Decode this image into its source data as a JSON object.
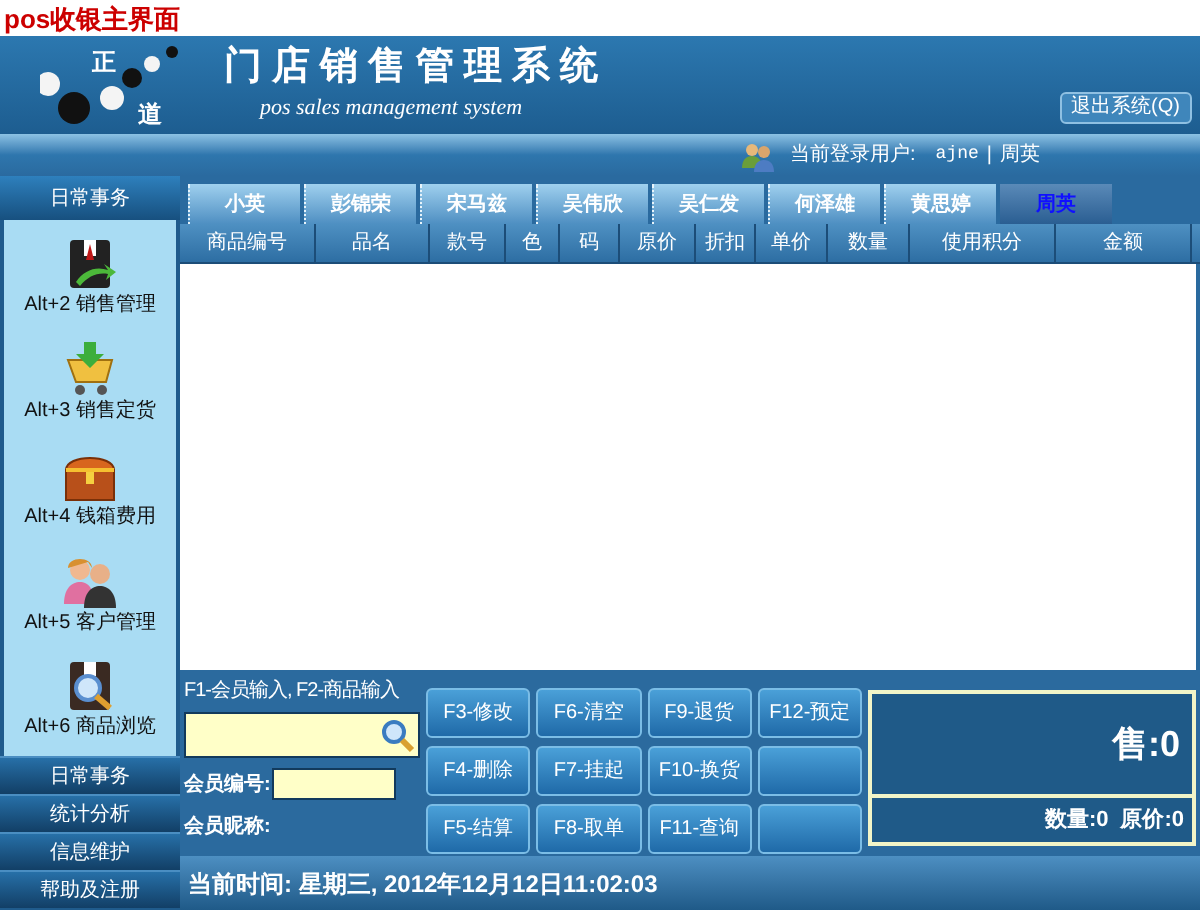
{
  "page_title": "pos收银主界面",
  "header": {
    "logo_chars": [
      "正",
      "道"
    ],
    "title": "门店销售管理系统",
    "subtitle": "pos sales management system",
    "logout_button": "退出系统(Q)"
  },
  "user_bar": {
    "label": "当前登录用户:",
    "username": "ajne",
    "separator": "|",
    "name": "周英"
  },
  "sidebar": {
    "sections": [
      {
        "label": "日常事务",
        "expanded": true,
        "items": [
          {
            "shortcut": "Alt+2",
            "label": "销售管理",
            "kind": "suit"
          },
          {
            "shortcut": "Alt+3",
            "label": "销售定货",
            "kind": "cart"
          },
          {
            "shortcut": "Alt+4",
            "label": "钱箱费用",
            "kind": "chest"
          },
          {
            "shortcut": "Alt+5",
            "label": "客户管理",
            "kind": "people"
          },
          {
            "shortcut": "Alt+6",
            "label": "商品浏览",
            "kind": "browse"
          }
        ]
      },
      {
        "label": "日常事务",
        "expanded": false
      },
      {
        "label": "统计分析",
        "expanded": false
      },
      {
        "label": "信息维护",
        "expanded": false
      },
      {
        "label": "帮助及注册",
        "expanded": false
      }
    ]
  },
  "tabs": [
    {
      "label": "小英",
      "selected": false
    },
    {
      "label": "彭锦荣",
      "selected": false
    },
    {
      "label": "宋马兹",
      "selected": false
    },
    {
      "label": "吴伟欣",
      "selected": false
    },
    {
      "label": "吴仁发",
      "selected": false
    },
    {
      "label": "何泽雄",
      "selected": false
    },
    {
      "label": "黄思婷",
      "selected": false
    },
    {
      "label": "周英",
      "selected": true
    }
  ],
  "table": {
    "columns": [
      "商品编号",
      "品名",
      "款号",
      "色",
      "码",
      "原价",
      "折扣",
      "单价",
      "数量",
      "使用积分",
      "金额"
    ]
  },
  "member_panel": {
    "hint": "F1-会员输入, F2-商品输入",
    "member_no_label": "会员编号:",
    "member_nick_label": "会员昵称:"
  },
  "function_keys": [
    {
      "kind": "key",
      "label": "F3-修改"
    },
    {
      "kind": "key",
      "label": "F6-清空"
    },
    {
      "kind": "key",
      "label": "F9-退货"
    },
    {
      "kind": "key",
      "label": "F12-预定"
    },
    {
      "kind": "key",
      "label": "F4-删除"
    },
    {
      "kind": "key",
      "label": "F7-挂起"
    },
    {
      "kind": "key",
      "label": "F10-换货"
    },
    {
      "kind": "blank"
    },
    {
      "kind": "key",
      "label": "F5-结算"
    },
    {
      "kind": "key",
      "label": "F8-取单"
    },
    {
      "kind": "key",
      "label": "F11-查询"
    },
    {
      "kind": "blank"
    }
  ],
  "totals": {
    "sale": "售:0",
    "quantity": "数量:0",
    "original_price": "原价:0"
  },
  "status_bar": {
    "current_time": "当前时间: 星期三, 2012年12月12日11:02:03"
  }
}
